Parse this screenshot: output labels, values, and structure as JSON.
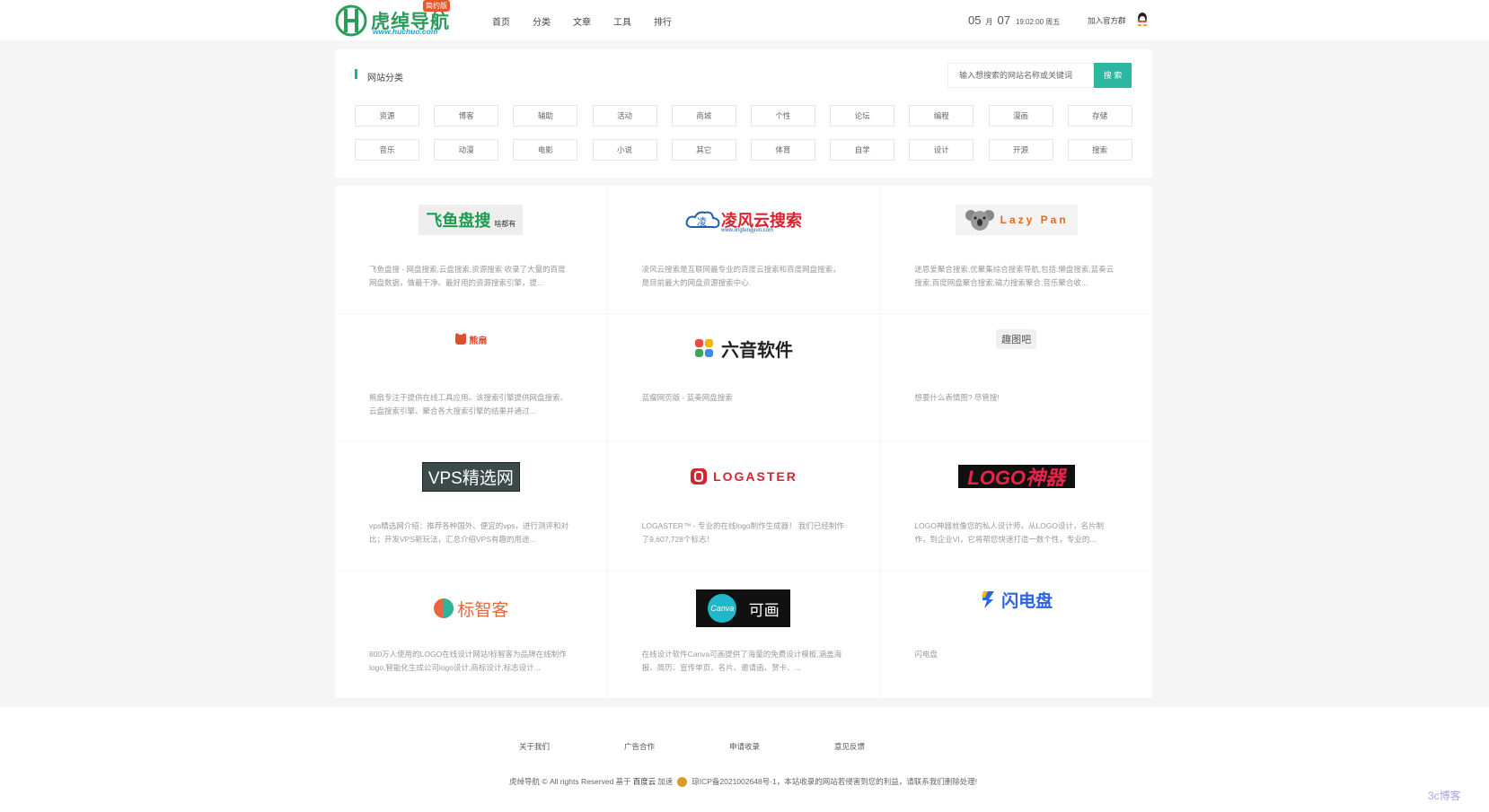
{
  "logo": {
    "title": "虎绰导航",
    "url": "www.huchuo.com",
    "badge": "简约版"
  },
  "nav": [
    "首页",
    "分类",
    "文章",
    "工具",
    "排行"
  ],
  "date": {
    "month": "05",
    "month_unit": "月",
    "day": "07",
    "time": "19:02:00 周五"
  },
  "header_join": "加入官方群",
  "category": {
    "title": "网站分类",
    "search_placeholder": "输入想搜索的网站名称或关键词",
    "search_button": "搜 索",
    "items": [
      "资源",
      "博客",
      "辅助",
      "活动",
      "商城",
      "个性",
      "论坛",
      "编程",
      "漫画",
      "存储",
      "音乐",
      "动漫",
      "电影",
      "小说",
      "其它",
      "体育",
      "自学",
      "设计",
      "开源",
      "搜索"
    ]
  },
  "cards": [
    {
      "logo_a": "飞鱼盘搜",
      "logo_b": "啥都有",
      "desc": "飞鱼盘搜 - 网盘搜索,云盘搜索,资源搜索 收录了大量的百度网盘数据，做最干净、最好用的资源搜索引擎，提..."
    },
    {
      "logo_a": "凌风云搜索",
      "logo_b": "www.lingfengyun.com",
      "desc": "凌风云搜索是互联网最专业的百度云搜索和百度网盘搜索，是目前最大的网盘资源搜索中心."
    },
    {
      "logo_a": "Lazy Pan",
      "desc": "迷恩爱聚合搜索,优聚集综合搜索导航,包括:懒盘搜索,蓝奏云搜索,百度网盘聚合搜索,磁力搜索聚合,音乐聚合收..."
    },
    {
      "logo_a": "熊扇",
      "desc": "熊扇专注于提供在线工具应用。该搜索引擎提供网盘搜索、云盘搜索引擎、聚合各大搜索引擎的结果并通过..."
    },
    {
      "logo_a": "六音软件",
      "desc": "蓝瘦网页版 - 蓝奏网盘搜索"
    },
    {
      "logo_a": "趣图吧",
      "desc": "想要什么表情图? 尽管搜!"
    },
    {
      "logo_a": "VPS精选网",
      "desc": "vps精选网介绍：推荐各种国外、便宜的vps，进行测评和对比；开发VPS新玩法，汇总介绍VPS有趣的用途..."
    },
    {
      "logo_a": "LOGASTER",
      "desc": "LOGASTER™ - 专业的在线logo制作生成器！ 我们已经制作了9,607,728个标志！"
    },
    {
      "logo_a": "LOGO神器",
      "desc": "LOGO神器就像您的私人设计师，从LOGO设计，名片制作，到企业VI，它将帮您快速打造一数个性，专业的..."
    },
    {
      "logo_a": "标智客",
      "desc": "800万人使用的LOGO在线设计网站!标智客为品牌在线制作logo,智能化生成公司logo设计,商标设计,标志设计..."
    },
    {
      "logo_a": "Canva",
      "logo_b": "可画",
      "desc": "在线设计软件Canva可画提供了海量的免费设计模板,涵盖海报、简历、宣传单页、名片、邀请函、贺卡、..."
    },
    {
      "logo_a": "闪电盘",
      "desc": "闪电盘"
    }
  ],
  "footer": {
    "links": [
      "关于我们",
      "广告合作",
      "申请收录",
      "意见反馈"
    ],
    "copy_a": "虎绰导航 © All rights Reserved 基于",
    "copy_b": "百度云",
    "copy_c": "加速",
    "copy_d": "琼ICP备2021002648号-1，本站收录的网站若侵害到您的利益，请联系我们删除处理!"
  },
  "watermark": "3c博客",
  "colors": {
    "accent": "#2db7a0",
    "brand_green": "#2e9b5b",
    "background": "#f5f5f5"
  }
}
